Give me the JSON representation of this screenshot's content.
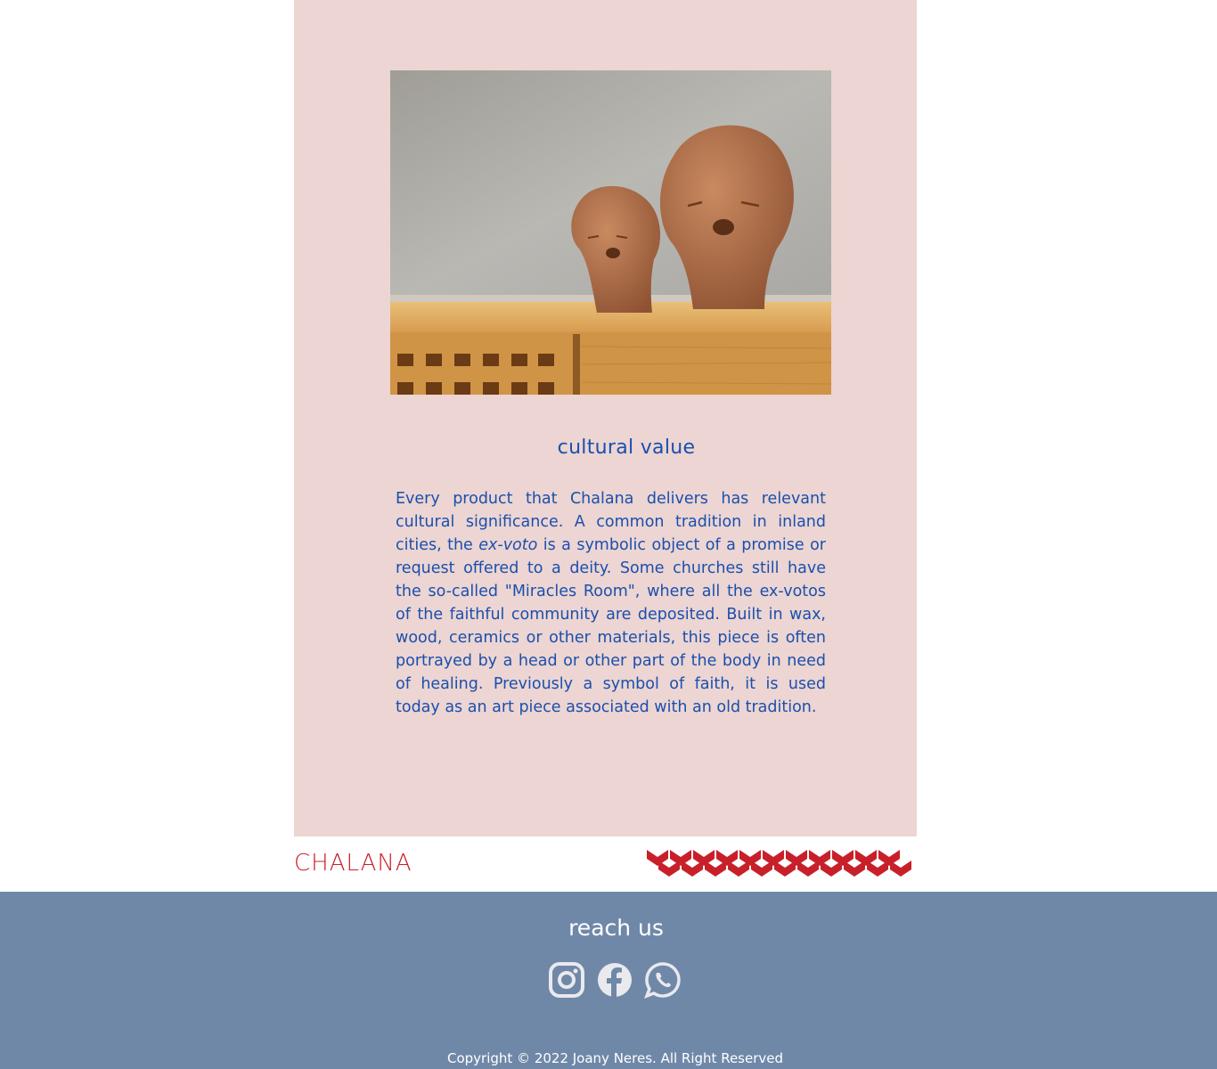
{
  "article": {
    "image_alt": "two terracotta ex-voto head sculptures on a wooden cabinet",
    "title": "cultural value",
    "paragraph_before": "Every product that Chalana delivers has relevant cultural significance. A common tradition in inland cities, the ",
    "paragraph_emphasis": "ex-voto",
    "paragraph_after": " is a symbolic object of a promise or request offered to a deity. Some churches still have the so-called \"Miracles Room\", where all the ex-votos of the faithful community are deposited. Built in wax, wood, ceramics or other materials, this piece is often portrayed by a head or other part of the body in need of healing. Previously a symbol of faith, it is used today as an art piece associated with an old tradition."
  },
  "brand": {
    "logo_text": "CHALANA",
    "accent_color": "#c8202a"
  },
  "footer": {
    "title": "reach us",
    "social": [
      "instagram-icon",
      "facebook-icon",
      "whatsapp-icon"
    ],
    "copyright": "Copyright © 2022 Joany Neres. All Right Reserved",
    "background": "#7088a8"
  },
  "colors": {
    "card_background": "#ecd5d2",
    "text_blue": "#1b4fae"
  }
}
